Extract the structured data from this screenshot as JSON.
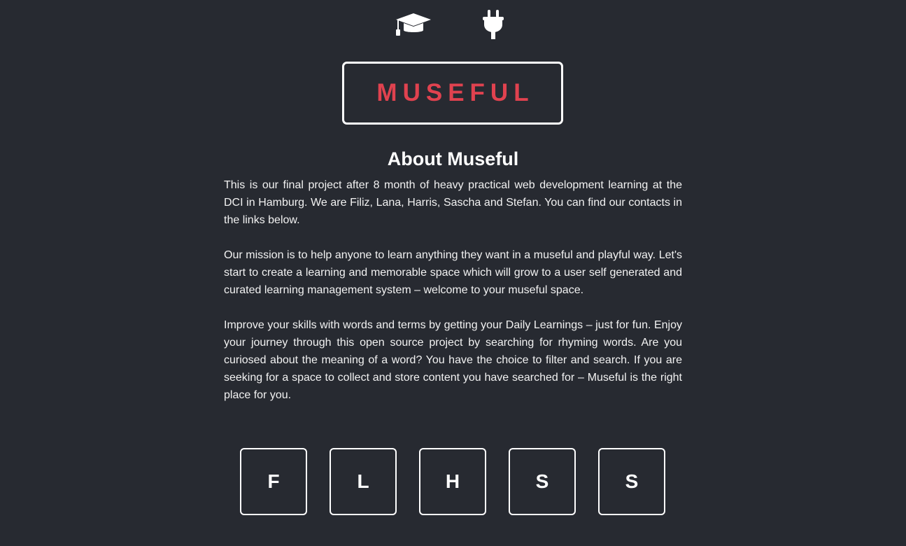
{
  "nav": {
    "icons": [
      "graduation-cap-icon",
      "plug-icon"
    ]
  },
  "logo": {
    "text": "MUSEFUL",
    "color": "#e0424f"
  },
  "about": {
    "title": "About Museful",
    "paragraphs": [
      "This is our final project after 8 month of heavy practical web development learning at the DCI in Hamburg. We are Filiz, Lana, Harris, Sascha and Stefan. You can find our contacts in the links below.",
      "Our mission is to help anyone to learn anything they want in a museful and playful way. Let's start to create a learning and memorable space which will grow to a user self generated and curated learning management system – welcome to your museful space.",
      "Improve your skills with words and terms by getting your Daily Learnings – just for fun. Enjoy your journey through this open source project by searching for rhyming words. Are you curiosed about the meaning of a word? You have the choice to filter and search. If you are seeking for a space to collect and store content you have searched for – Museful is the right place for you."
    ]
  },
  "team": {
    "members": [
      {
        "initial": "F"
      },
      {
        "initial": "L"
      },
      {
        "initial": "H"
      },
      {
        "initial": "S"
      },
      {
        "initial": "S"
      }
    ]
  },
  "colors": {
    "background": "#272a31",
    "text": "#ffffff",
    "accent": "#e0424f"
  }
}
